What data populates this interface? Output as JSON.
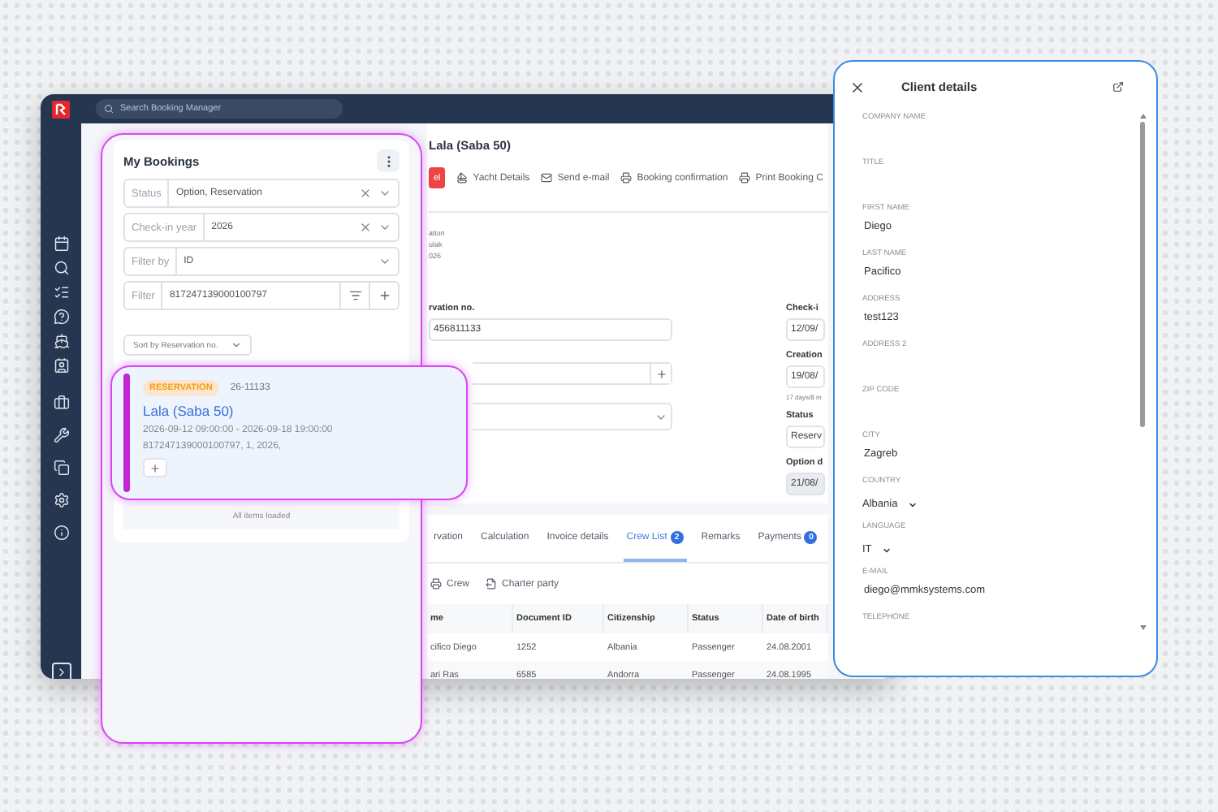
{
  "topbar": {
    "search_placeholder": "Search Booking Manager"
  },
  "booking_header": {
    "title": "Lala (Saba 50)",
    "actions": [
      {
        "kind": "danger",
        "label": "el"
      },
      {
        "kind": "yacht",
        "label": "Yacht Details"
      },
      {
        "kind": "mail",
        "label": "Send e-mail"
      },
      {
        "kind": "print",
        "label": "Booking confirmation"
      },
      {
        "kind": "print",
        "label": "Print Booking C"
      }
    ]
  },
  "info_lines": [
    "ation",
    "ulak",
    "026"
  ],
  "form_left": [
    {
      "kind": "text",
      "label": "rvation no.",
      "value": "456811133"
    },
    {
      "kind": "add"
    },
    {
      "kind": "select"
    }
  ],
  "form_right": [
    {
      "label": "Check-i",
      "value": "12/09/",
      "disabled": false
    },
    {
      "label": "Creation",
      "value": "19/08/",
      "note": "17 days/8 m",
      "disabled": false
    },
    {
      "label": "Status",
      "value": "Reserv",
      "disabled": false
    },
    {
      "label": "Option d",
      "value": "21/08/",
      "disabled": true
    }
  ],
  "tabs": [
    {
      "label": "rvation",
      "selected": false
    },
    {
      "label": "Calculation",
      "selected": false
    },
    {
      "label": "Invoice details",
      "selected": false
    },
    {
      "label": "Crew List",
      "badge": "2",
      "selected": true
    },
    {
      "label": "Remarks",
      "selected": false
    },
    {
      "label": "Payments",
      "badge": "0",
      "selected": false
    }
  ],
  "crew_actions": [
    {
      "kind": "print",
      "label": "Crew"
    },
    {
      "kind": "export",
      "label": "Charter party"
    }
  ],
  "crew_table": {
    "columns": [
      "me",
      "Document ID",
      "Citizenship",
      "Status",
      "Date of birth"
    ],
    "rows": [
      [
        "cifico Diego",
        "1252",
        "Albania",
        "Passenger",
        "24.08.2001"
      ],
      [
        "ari Ras",
        "6585",
        "Andorra",
        "Passenger",
        "24.08.1995"
      ]
    ]
  },
  "my_bookings": {
    "title": "My Bookings",
    "filters": [
      {
        "kind": "select",
        "label": "Status",
        "value": "Option, Reservation",
        "clearable": true
      },
      {
        "kind": "select",
        "label": "Check-in year",
        "value": "2026",
        "clearable": true
      },
      {
        "kind": "select",
        "label": "Filter by",
        "value": "ID",
        "clearable": false
      },
      {
        "kind": "filter",
        "label": "Filter",
        "value": "817247139000100797"
      }
    ],
    "sort": "Sort by Reservation no.",
    "footer": "All items loaded"
  },
  "booking_card": {
    "status": "RESERVATION",
    "number": "26-11133",
    "title": "Lala (Saba 50)",
    "dates": "2026-09-12 09:00:00 - 2026-09-18 19:00:00",
    "details": "817247139000100797, 1, 2026,"
  },
  "client_details": {
    "title": "Client details",
    "fields": [
      {
        "kind": "text",
        "label": "COMPANY NAME"
      },
      {
        "kind": "text",
        "label": "TITLE"
      },
      {
        "kind": "text",
        "label": "FIRST NAME",
        "value": "Diego"
      },
      {
        "kind": "text",
        "label": "LAST NAME",
        "value": "Pacifico"
      },
      {
        "kind": "text",
        "label": "ADDRESS",
        "value": "test123"
      },
      {
        "kind": "text",
        "label": "ADDRESS 2"
      },
      {
        "kind": "text",
        "label": "ZIP CODE"
      },
      {
        "kind": "text",
        "label": "CITY",
        "value": "Zagreb"
      },
      {
        "kind": "select",
        "label": "COUNTRY",
        "value": "Albania"
      },
      {
        "kind": "select",
        "label": "LANGUAGE",
        "value": "IT"
      },
      {
        "kind": "text",
        "label": "E-MAIL",
        "value": "diego@mmksystems.com"
      },
      {
        "kind": "text",
        "label": "TELEPHONE"
      }
    ]
  }
}
